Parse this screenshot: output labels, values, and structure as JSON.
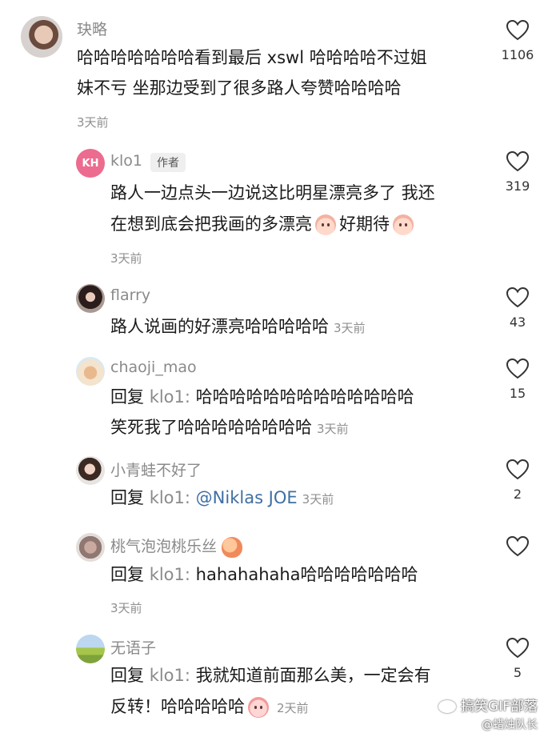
{
  "comments": [
    {
      "user": "玦略",
      "lines": [
        "哈哈哈哈哈哈哈看到最后 xswl 哈哈哈哈不过姐",
        "妹不亏 坐那边受到了很多路人夸赞哈哈哈哈"
      ],
      "time": "3天前",
      "likes": "1106"
    },
    {
      "user": "klo1",
      "avatar_text": "KH",
      "badge": "作者",
      "line1": "路人一边点头一边说这比明星漂亮多了 我还",
      "line2a": "在想到底会把我画的多漂亮",
      "line2b": "好期待",
      "time": "3天前",
      "likes": "319"
    },
    {
      "user": "flarry",
      "text": "路人说画的好漂亮哈哈哈哈哈",
      "time": "3天前",
      "likes": "43"
    },
    {
      "user": "chaoji_mao",
      "reply_kw": "回复",
      "reply_target": "klo1:",
      "line1": "哈哈哈哈哈哈哈哈哈哈哈哈哈",
      "line2": "笑死我了哈哈哈哈哈哈哈哈",
      "time": "3天前",
      "likes": "15"
    },
    {
      "user": "小青蛙不好了",
      "reply_kw": "回复",
      "reply_target": "klo1:",
      "mention": "@Niklas JOE",
      "time": "3天前",
      "likes": "2"
    },
    {
      "user": "桃气泡泡桃乐丝",
      "reply_kw": "回复",
      "reply_target": "klo1:",
      "text": "hahahahaha哈哈哈哈哈哈哈",
      "time": "3天前",
      "likes": ""
    },
    {
      "user": "无语子",
      "reply_kw": "回复",
      "reply_target": "klo1:",
      "line1": "我就知道前面那么美，一定会有",
      "line2": "反转！哈哈哈哈哈",
      "time": "2天前",
      "likes": "5"
    }
  ],
  "watermark": {
    "line1": "搞笑GIF部落",
    "line2": "@蜡烛队长"
  },
  "icons": {
    "like": "heart-outline-icon",
    "emoji_smile": "blush-face-emoji",
    "emoji_cry": "crying-face-emoji",
    "emoji_peach": "peach-emoji"
  }
}
